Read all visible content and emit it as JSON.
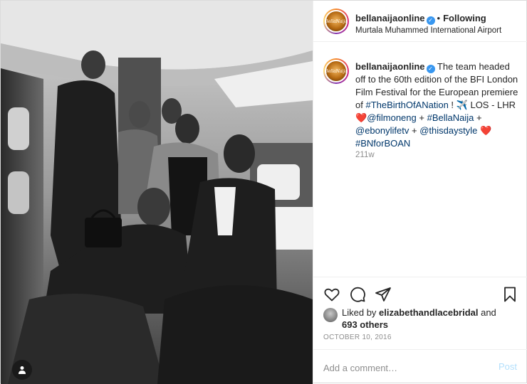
{
  "post": {
    "username": "bellanaijaonline",
    "verified": true,
    "follow_status": "Following",
    "location": "Murtala Muhammed International Airport",
    "avatar_mark": "BellaNaija",
    "caption": {
      "text_1": "The team headed off to the 60th edition of the BFI London Film Festival for the European premiere of ",
      "hashtag_1": "#TheBirthOfANation",
      "text_2": " ! ",
      "plane_icon": "✈️",
      "text_3": "LOS - LHR ",
      "heart_1": "❤️",
      "mention_1": "@filmoneng",
      "text_4": " + ",
      "hashtag_2": "#BellaNaija",
      "text_5": " + ",
      "mention_2": "@ebonylifetv",
      "text_6": " + ",
      "mention_3": "@thisdaystyle",
      "text_7": " ",
      "heart_2": "❤️",
      "hashtag_3": "#BNforBOAN"
    },
    "age": "211w",
    "likes": {
      "prefix": "Liked by ",
      "user": "elizabethandlacebridal",
      "middle": " and",
      "count": "693 others"
    },
    "date": "OCTOBER 10, 2016",
    "comment_placeholder": "Add a comment…",
    "post_label": "Post"
  },
  "icons": {
    "like": "heart-outline-icon",
    "comment": "speech-bubble-icon",
    "share": "paper-plane-icon",
    "save": "bookmark-icon",
    "tagged": "person-tag-icon"
  },
  "colors": {
    "link": "#00376b",
    "verified": "#3897f0",
    "post_button_disabled": "#b2dffc",
    "muted": "#8e8e8e"
  }
}
